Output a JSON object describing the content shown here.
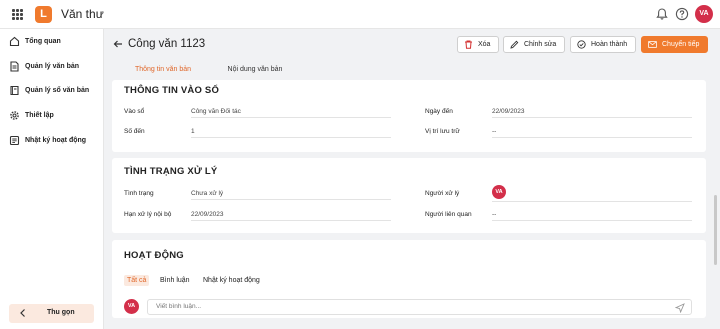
{
  "app": {
    "logo_letter": "L",
    "title": "Văn thư",
    "user_initials": "VA"
  },
  "sidebar": {
    "items": [
      {
        "label": "Tổng quan",
        "icon": "home-icon"
      },
      {
        "label": "Quản lý văn bản",
        "icon": "document-icon"
      },
      {
        "label": "Quản lý sổ văn bản",
        "icon": "book-icon"
      },
      {
        "label": "Thiết lập",
        "icon": "gear-icon"
      },
      {
        "label": "Nhật ký hoạt động",
        "icon": "log-icon"
      }
    ],
    "collapse_label": "Thu gọn"
  },
  "header": {
    "title": "Công văn 1123",
    "buttons": {
      "delete": "Xóa",
      "edit": "Chỉnh sửa",
      "complete": "Hoàn thành",
      "forward": "Chuyển tiếp"
    }
  },
  "tabs": {
    "info": "Thông tin văn bản",
    "content": "Nội dung văn bản"
  },
  "entry_section": {
    "title": "THÔNG TIN VÀO SỔ",
    "fields": {
      "book_label": "Vào sổ",
      "book_value": "Công văn Đối tác",
      "arrival_date_label": "Ngày đến",
      "arrival_date_value": "22/09/2023",
      "arrival_no_label": "Số đến",
      "arrival_no_value": "1",
      "storage_label": "Vị trí lưu trữ",
      "storage_value": "--"
    }
  },
  "status_section": {
    "title": "TÌNH TRẠNG XỬ LÝ",
    "fields": {
      "status_label": "Tình trạng",
      "status_value": "Chưa xử lý",
      "handler_label": "Người xử lý",
      "handler_initials": "VA",
      "deadline_label": "Hạn xử lý nội bộ",
      "deadline_value": "22/09/2023",
      "related_label": "Người liên quan",
      "related_value": "--"
    }
  },
  "activity_section": {
    "title": "HOẠT ĐỘNG",
    "tabs": {
      "all": "Tất cả",
      "comments": "Bình luận",
      "log": "Nhật ký hoạt động"
    },
    "comment_placeholder": "Viết bình luận...",
    "user_initials": "VA"
  },
  "colors": {
    "accent": "#f07a2d",
    "avatar": "#d32f4a"
  }
}
